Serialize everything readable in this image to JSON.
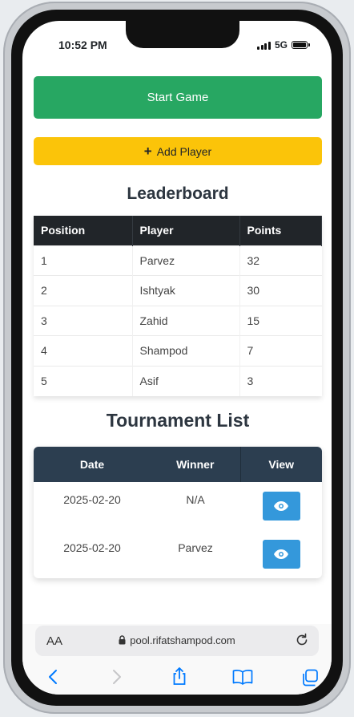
{
  "status_bar": {
    "time": "10:52 PM",
    "network": "5G"
  },
  "actions": {
    "start_game": "Start Game",
    "add_player": "Add Player"
  },
  "leaderboard": {
    "title": "Leaderboard",
    "columns": [
      "Position",
      "Player",
      "Points"
    ],
    "rows": [
      [
        "1",
        "Parvez",
        "32"
      ],
      [
        "2",
        "Ishtyak",
        "30"
      ],
      [
        "3",
        "Zahid",
        "15"
      ],
      [
        "4",
        "Shampod",
        "7"
      ],
      [
        "5",
        "Asif",
        "3"
      ]
    ]
  },
  "tournaments": {
    "title": "Tournament List",
    "columns": [
      "Date",
      "Winner",
      "View"
    ],
    "rows": [
      [
        "2025-02-20",
        "N/A"
      ],
      [
        "2025-02-20",
        "Parvez"
      ]
    ]
  },
  "browser": {
    "text_size_label": "AA",
    "url": "pool.rifatshampod.com"
  },
  "icons": {
    "add": "plus-icon",
    "view": "eye-icon",
    "lock": "lock-icon",
    "reload": "reload-icon",
    "back": "chevron-left-icon",
    "forward": "chevron-right-icon",
    "share": "share-icon",
    "bookmarks": "book-icon",
    "tabs": "tabs-icon"
  },
  "colors": {
    "start": "#27a762",
    "add": "#fbc409",
    "table_head": "#212529",
    "tournament_head": "#2c3e50",
    "view": "#3498db",
    "safari_accent": "#007aff"
  }
}
